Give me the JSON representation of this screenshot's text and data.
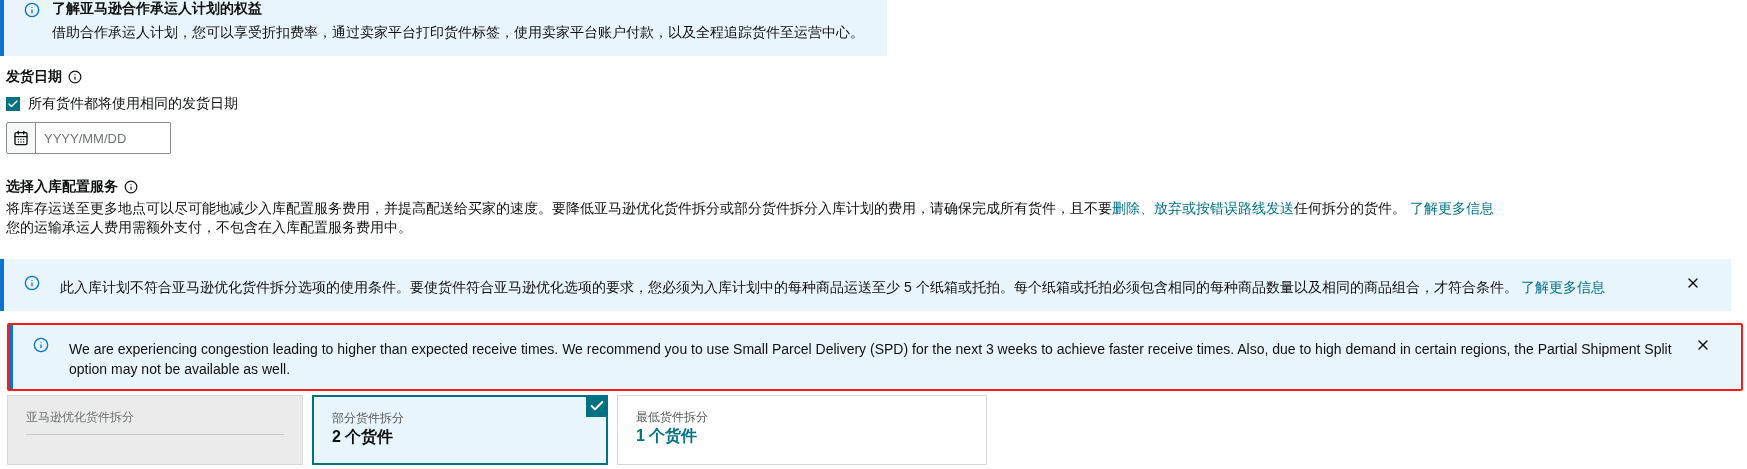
{
  "partner_banner": {
    "title": "了解亚马逊合作承运人计划的权益",
    "body": "借助合作承运人计划，您可以享受折扣费率，通过卖家平台打印货件标签，使用卖家平台账户付款，以及全程追踪货件至运营中心。"
  },
  "ship_date": {
    "label": "发货日期",
    "same_date": {
      "label": "所有货件都将使用相同的发货日期",
      "checked": true
    },
    "date_field": {
      "placeholder": "YYYY/MM/DD"
    }
  },
  "placement": {
    "title": "选择入库配置服务",
    "desc_before": "将库存运送至更多地点可以尽可能地减少入库配置服务费用，并提高配送给买家的速度。要降低亚马逊优化货件拆分或部分货件拆分入库计划的费用，请确保完成所有货件，且不要",
    "desc_link": "删除、放弃或按错误路线发送",
    "desc_after": "任何拆分的货件。",
    "learn_more": "了解更多信息",
    "note": "您的运输承运人费用需额外支付，不包含在入库配置服务费用中。"
  },
  "alerts": [
    {
      "text": "此入库计划不符合亚马逊优化货件拆分选项的使用条件。要使货件符合亚马逊优化选项的要求，您必须为入库计划中的每种商品运送至少 5 个纸箱或托拍。每个纸箱或托拍必须包含相同的每种商品数量以及相同的商品组合，才符合条件。",
      "link": "了解更多信息",
      "highlighted": false
    },
    {
      "text": "We are experiencing congestion leading to higher than expected receive times. We recommend you to use Small Parcel Delivery (SPD) for the next 3 weeks to achieve faster receive times. Also, due to high demand in certain regions, the Partial Shipment Split option may not be available as well.",
      "highlighted": true
    }
  ],
  "options": [
    {
      "label": "亚马逊优化货件拆分",
      "disabled": true,
      "selected": false
    },
    {
      "label": "部分货件拆分",
      "count": "2 个货件",
      "disabled": false,
      "selected": true
    },
    {
      "label": "最低货件拆分",
      "count": "1 个货件",
      "disabled": false,
      "selected": false
    }
  ]
}
